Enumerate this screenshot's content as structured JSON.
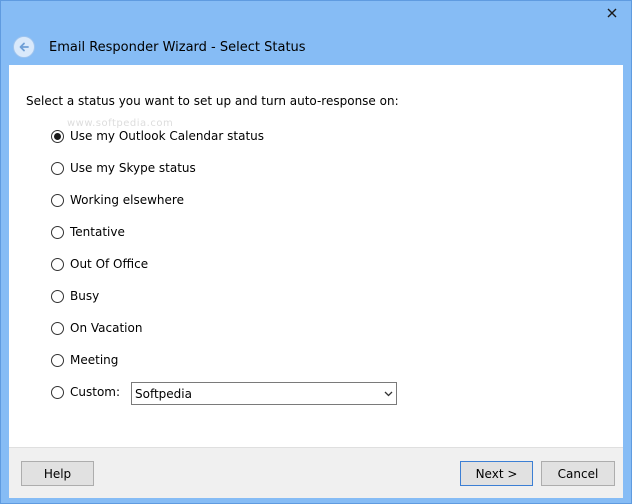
{
  "window": {
    "title": "Email Responder Wizard - Select Status"
  },
  "content": {
    "instruction": "Select a status you want to set up and turn auto-response on:",
    "watermark": "www.softpedia.com",
    "options": [
      {
        "label": "Use my Outlook Calendar status",
        "checked": true
      },
      {
        "label": "Use my Skype status",
        "checked": false
      },
      {
        "label": "Working elsewhere",
        "checked": false
      },
      {
        "label": "Tentative",
        "checked": false
      },
      {
        "label": "Out Of Office",
        "checked": false
      },
      {
        "label": "Busy",
        "checked": false
      },
      {
        "label": "On Vacation",
        "checked": false
      },
      {
        "label": "Meeting",
        "checked": false
      },
      {
        "label": "Custom:",
        "checked": false
      }
    ],
    "custom_value": "Softpedia"
  },
  "footer": {
    "help_label": "Help",
    "next_label": "Next >",
    "cancel_label": "Cancel"
  },
  "icons": {
    "close": "close-icon",
    "back": "back-arrow-icon",
    "dropdown": "chevron-down-icon"
  },
  "colors": {
    "window_frame": "#86bcf5",
    "content_bg": "#ffffff",
    "footer_bg": "#f0f0f0",
    "default_button_border": "#3c7fd4"
  }
}
